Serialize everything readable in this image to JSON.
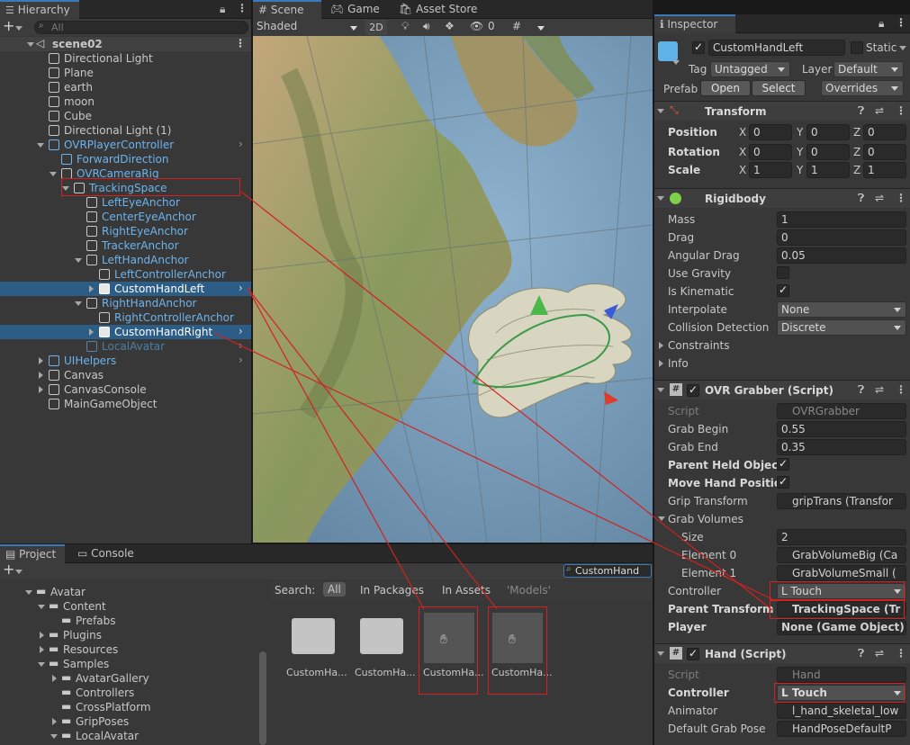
{
  "hierarchy": {
    "tab": "Hierarchy",
    "search_placeholder": "All",
    "scene": "scene02",
    "items": [
      {
        "label": "Directional Light"
      },
      {
        "label": "Plane"
      },
      {
        "label": "earth"
      },
      {
        "label": "moon"
      },
      {
        "label": "Cube"
      },
      {
        "label": "Directional Light (1)"
      },
      {
        "label": "OVRPlayerController"
      },
      {
        "label": "ForwardDirection"
      },
      {
        "label": "OVRCameraRig"
      },
      {
        "label": "TrackingSpace"
      },
      {
        "label": "LeftEyeAnchor"
      },
      {
        "label": "CenterEyeAnchor"
      },
      {
        "label": "RightEyeAnchor"
      },
      {
        "label": "TrackerAnchor"
      },
      {
        "label": "LeftHandAnchor"
      },
      {
        "label": "LeftControllerAnchor"
      },
      {
        "label": "CustomHandLeft"
      },
      {
        "label": "RightHandAnchor"
      },
      {
        "label": "RightControllerAnchor"
      },
      {
        "label": "CustomHandRight"
      },
      {
        "label": "LocalAvatar"
      },
      {
        "label": "UIHelpers"
      },
      {
        "label": "Canvas"
      },
      {
        "label": "CanvasConsole"
      },
      {
        "label": "MainGameObject"
      }
    ]
  },
  "scene": {
    "tabs": {
      "scene": "Scene",
      "game": "Game",
      "store": "Asset Store"
    },
    "shading": "Shaded",
    "mode_2d": "2D",
    "hidden_count": "0"
  },
  "project": {
    "tabs": {
      "project": "Project",
      "console": "Console"
    },
    "search_value": "CustomHand",
    "search_label": "Search:",
    "filters": [
      "All",
      "In Packages",
      "In Assets",
      "'Models'"
    ],
    "tree": [
      {
        "label": "Avatar"
      },
      {
        "label": "Content"
      },
      {
        "label": "Prefabs"
      },
      {
        "label": "Plugins"
      },
      {
        "label": "Resources"
      },
      {
        "label": "Samples"
      },
      {
        "label": "AvatarGallery"
      },
      {
        "label": "Controllers"
      },
      {
        "label": "CrossPlatform"
      },
      {
        "label": "GripPoses"
      },
      {
        "label": "LocalAvatar"
      }
    ],
    "assets": [
      "CustomHa...",
      "CustomHa...",
      "CustomHa...",
      "CustomHa..."
    ]
  },
  "inspector": {
    "tab": "Inspector",
    "object_name": "CustomHandLeft",
    "static_label": "Static",
    "tag_label": "Tag",
    "tag_value": "Untagged",
    "layer_label": "Layer",
    "layer_value": "Default",
    "prefab_label": "Prefab",
    "open_btn": "Open",
    "select_btn": "Select",
    "overrides": "Overrides",
    "transform": {
      "title": "Transform",
      "position": "Position",
      "rotation": "Rotation",
      "scale": "Scale",
      "pos": [
        "0",
        "0",
        "0"
      ],
      "rot": [
        "0",
        "0",
        "0"
      ],
      "scl": [
        "1",
        "1",
        "1"
      ],
      "x": "X",
      "y": "Y",
      "z": "Z"
    },
    "rigidbody": {
      "title": "Rigidbody",
      "mass_l": "Mass",
      "mass": "1",
      "drag_l": "Drag",
      "drag": "0",
      "adrag_l": "Angular Drag",
      "adrag": "0.05",
      "gravity_l": "Use Gravity",
      "kinematic_l": "Is Kinematic",
      "interp_l": "Interpolate",
      "interp": "None",
      "coll_l": "Collision Detection",
      "coll": "Discrete",
      "constraints": "Constraints",
      "info": "Info"
    },
    "grabber": {
      "title": "OVR Grabber (Script)",
      "script_l": "Script",
      "script": "OVRGrabber",
      "gbegin_l": "Grab Begin",
      "gbegin": "0.55",
      "gend_l": "Grab End",
      "gend": "0.35",
      "parent_held_l": "Parent Held Object",
      "move_hand_l": "Move Hand Position",
      "grip_l": "Grip Transform",
      "grip": "gripTrans (Transfor",
      "volumes_l": "Grab Volumes",
      "size_l": "Size",
      "size": "2",
      "el0_l": "Element 0",
      "el0": "GrabVolumeBig (Ca",
      "el1_l": "Element 1",
      "el1": "GrabVolumeSmall (",
      "ctrl_l": "Controller",
      "ctrl": "L Touch",
      "ptrans_l": "Parent Transform",
      "ptrans": "TrackingSpace (Tr",
      "player_l": "Player",
      "player": "None (Game Object)"
    },
    "hand": {
      "title": "Hand (Script)",
      "script_l": "Script",
      "script": "Hand",
      "ctrl_l": "Controller",
      "ctrl": "L Touch",
      "anim_l": "Animator",
      "anim": "l_hand_skeletal_low",
      "pose_l": "Default Grab Pose",
      "pose": "HandPoseDefaultP"
    }
  },
  "colors": {
    "accent": "#3a79bb",
    "selection": "#2c5d87",
    "annotation": "#d42020"
  }
}
